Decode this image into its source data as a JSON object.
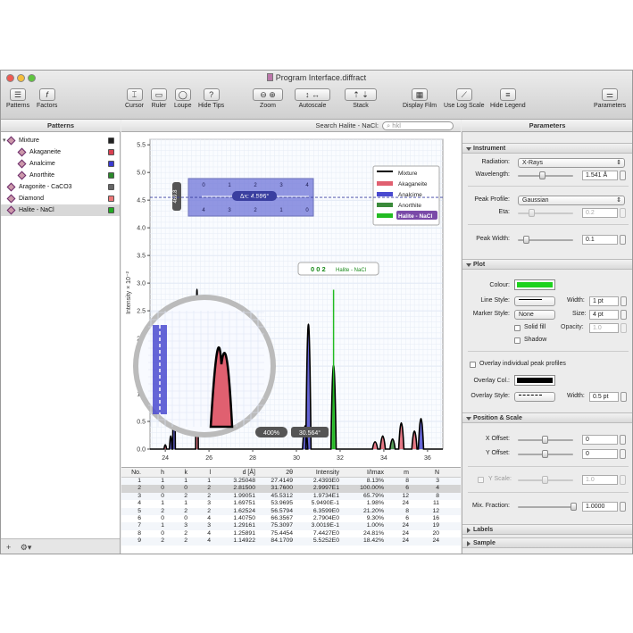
{
  "window": {
    "title": "Program Interface.diffract"
  },
  "toolbar": {
    "items": [
      {
        "label": "Patterns",
        "icon": "list-icon"
      },
      {
        "label": "Factors",
        "icon": "function-icon"
      },
      {
        "label": "Cursor",
        "icon": "cursor-icon"
      },
      {
        "label": "Ruler",
        "icon": "ruler-icon"
      },
      {
        "label": "Loupe",
        "icon": "loupe-icon"
      },
      {
        "label": "Hide Tips",
        "icon": "question-icon"
      },
      {
        "label": "Zoom",
        "icon": "zoom-icon"
      },
      {
        "label": "Autoscale",
        "icon": "autoscale-icon"
      },
      {
        "label": "Stack",
        "icon": "stack-icon"
      },
      {
        "label": "Display Film",
        "icon": "film-icon"
      },
      {
        "label": "Use Log Scale",
        "icon": "log-scale-icon"
      },
      {
        "label": "Hide Legend",
        "icon": "legend-icon"
      },
      {
        "label": "Parameters",
        "icon": "sliders-icon"
      }
    ]
  },
  "patterns_header": "Patterns",
  "search": {
    "label": "Search Halite - NaCl:",
    "placeholder": "hkl"
  },
  "parameters_header": "Parameters",
  "tree": [
    {
      "label": "Mixture",
      "level": 0,
      "color": "#222222",
      "expanded": true
    },
    {
      "label": "Akaganeite",
      "level": 1,
      "color": "#d94050"
    },
    {
      "label": "Analcime",
      "level": 1,
      "color": "#3a3ad0"
    },
    {
      "label": "Anorthite",
      "level": 1,
      "color": "#2a8a2a"
    },
    {
      "label": "Aragonite - CaCO3",
      "level": 0,
      "color": "#666666"
    },
    {
      "label": "Diamond",
      "level": 0,
      "color": "#ee7777"
    },
    {
      "label": "Halite - NaCl",
      "level": 0,
      "color": "#22aa22",
      "selected": true
    }
  ],
  "left_footer": {
    "add": "+",
    "gear": "⚙▾"
  },
  "chart_data": {
    "type": "line",
    "xlabel": "",
    "ylabel": "Intensity × 10⁻²",
    "xlim": [
      23.3,
      36.7
    ],
    "ylim": [
      0,
      5.6
    ],
    "x_ticks": [
      24,
      26,
      28,
      30,
      32,
      34,
      36
    ],
    "y_ticks": [
      0.0,
      0.5,
      1.0,
      1.5,
      2.0,
      2.5,
      3.0,
      3.5,
      4.0,
      4.5,
      5.0,
      5.5
    ],
    "grid": true,
    "legend_position": "top-right",
    "legend": [
      {
        "name": "Mixture",
        "color": "#000000"
      },
      {
        "name": "Akaganeite",
        "color": "#e06070"
      },
      {
        "name": "Analcime",
        "color": "#4a4ad0"
      },
      {
        "name": "Anorthite",
        "color": "#3a8a3a"
      },
      {
        "name": "Halite - NaCl",
        "color": "#22bb22",
        "selected": true
      }
    ],
    "peaks": [
      {
        "x": 24.0,
        "y": 0.15,
        "phase": "Akaganeite"
      },
      {
        "x": 24.25,
        "y": 0.45,
        "phase": "Analcime"
      },
      {
        "x": 24.4,
        "y": 3.95,
        "phase": "Analcime"
      },
      {
        "x": 25.45,
        "y": 5.5,
        "phase": "Akaganeite"
      },
      {
        "x": 30.4,
        "y": 0.8,
        "phase": "Analcime"
      },
      {
        "x": 30.55,
        "y": 4.3,
        "phase": "Analcime"
      },
      {
        "x": 31.7,
        "y": 2.88,
        "phase": "Halite - NaCl"
      },
      {
        "x": 33.6,
        "y": 0.25,
        "phase": "Akaganeite"
      },
      {
        "x": 33.95,
        "y": 0.45,
        "phase": "Akaganeite"
      },
      {
        "x": 34.4,
        "y": 0.35,
        "phase": "Anorthite"
      },
      {
        "x": 34.8,
        "y": 0.9,
        "phase": "Akaganeite"
      },
      {
        "x": 35.4,
        "y": 0.62,
        "phase": "Akaganeite"
      },
      {
        "x": 35.7,
        "y": 1.05,
        "phase": "Analcime"
      }
    ],
    "ruler": {
      "text": "Δx: 4.596°",
      "side_value": "469.8",
      "scale_ticks_top": [
        "0",
        "1",
        "2",
        "3",
        "4"
      ],
      "scale_ticks_bottom": [
        "4",
        "3",
        "2",
        "1",
        "0"
      ]
    },
    "tooltip": {
      "hkl": "0 0 2",
      "phase": "Halite - NaCl"
    },
    "loupe": {
      "zoom": "400%",
      "readout": "30.564°"
    }
  },
  "table": {
    "columns": [
      "No.",
      "h",
      "k",
      "l",
      "d [Å]",
      "2θ",
      "Intensity",
      "I/Imax",
      "m",
      "N"
    ],
    "rows": [
      [
        "1",
        "1",
        "1",
        "1",
        "3.25048",
        "27.4149",
        "2.4393E0",
        "8.13%",
        "8",
        "3"
      ],
      [
        "2",
        "0",
        "0",
        "2",
        "2.81500",
        "31.7600",
        "2.9997E1",
        "100.00%",
        "6",
        "4"
      ],
      [
        "3",
        "0",
        "2",
        "2",
        "1.99051",
        "45.5312",
        "1.9734E1",
        "65.79%",
        "12",
        "8"
      ],
      [
        "4",
        "1",
        "1",
        "3",
        "1.69751",
        "53.9695",
        "5.9490E-1",
        "1.98%",
        "24",
        "11"
      ],
      [
        "5",
        "2",
        "2",
        "2",
        "1.62524",
        "56.5794",
        "6.3599E0",
        "21.20%",
        "8",
        "12"
      ],
      [
        "6",
        "0",
        "0",
        "4",
        "1.40750",
        "66.3567",
        "2.7904E0",
        "9.30%",
        "6",
        "16"
      ],
      [
        "7",
        "1",
        "3",
        "3",
        "1.29161",
        "75.3097",
        "3.0019E-1",
        "1.00%",
        "24",
        "19"
      ],
      [
        "8",
        "0",
        "2",
        "4",
        "1.25891",
        "75.4454",
        "7.4427E0",
        "24.81%",
        "24",
        "20"
      ],
      [
        "9",
        "2",
        "2",
        "4",
        "1.14922",
        "84.1709",
        "5.5252E0",
        "18.42%",
        "24",
        "24"
      ]
    ]
  },
  "instrument": {
    "header": "Instrument",
    "radiation_label": "Radiation:",
    "radiation_value": "X-Rays",
    "wavelength_label": "Wavelength:",
    "wavelength_value": "1.541 Å",
    "peak_profile_label": "Peak Profile:",
    "peak_profile_value": "Gaussian",
    "eta_label": "Eta:",
    "eta_value": "0.2",
    "peak_width_label": "Peak Width:",
    "peak_width_value": "0.1"
  },
  "plot": {
    "header": "Plot",
    "colour_label": "Colour:",
    "colour_value": "#1ed21e",
    "line_style_label": "Line Style:",
    "width_label": "Width:",
    "width_value": "1 pt",
    "marker_style_label": "Marker Style:",
    "marker_style_value": "None",
    "size_label": "Size:",
    "size_value": "4 pt",
    "solid_fill_label": "Solid fill",
    "opacity_label": "Opacity:",
    "opacity_value": "1.0",
    "shadow_label": "Shadow",
    "overlay_label": "Overlay individual peak profiles",
    "overlay_col_label": "Overlay Col.:",
    "overlay_col_value": "#000000",
    "overlay_style_label": "Overlay Style:",
    "overlay_width_label": "Width:",
    "overlay_width_value": "0.5 pt"
  },
  "position": {
    "header": "Position & Scale",
    "x_offset_label": "X Offset:",
    "x_offset_value": "0",
    "y_offset_label": "Y Offset:",
    "y_offset_value": "0",
    "y_scale_label": "Y Scale:",
    "y_scale_value": "1.0",
    "mix_fraction_label": "Mix. Fraction:",
    "mix_fraction_value": "1.0000"
  },
  "labels_header": "Labels",
  "sample_header": "Sample"
}
